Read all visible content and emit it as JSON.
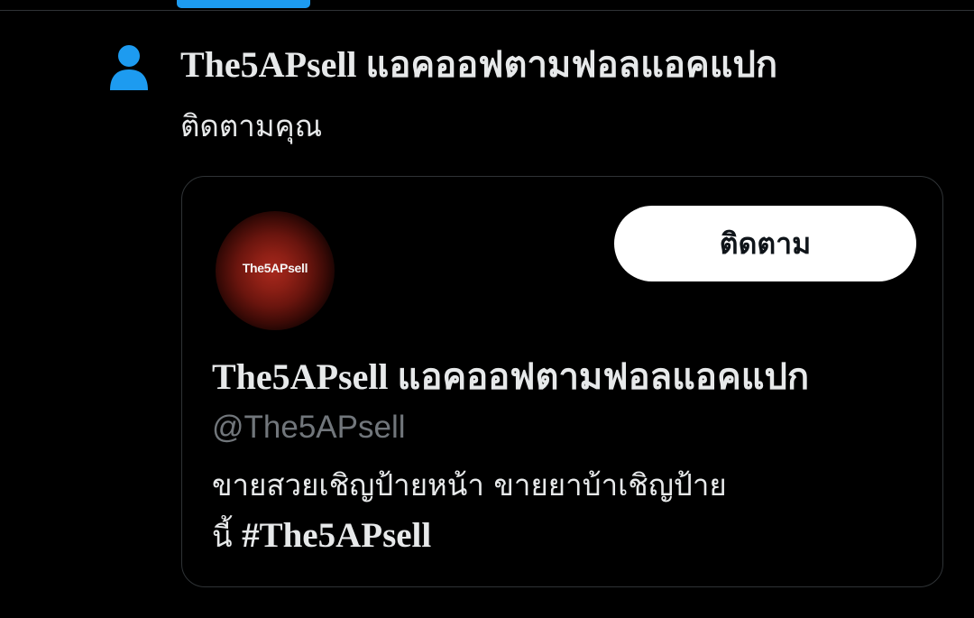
{
  "colors": {
    "background": "#000000",
    "text_primary": "#e7e9ea",
    "text_secondary": "#71767b",
    "accent": "#1d9bf0",
    "border": "#2f3336",
    "button_bg": "#ffffff",
    "button_text": "#0f1419"
  },
  "notification": {
    "icon": "person-icon",
    "title": "The5APsell แอคออฟตามฟอลแอคแปก",
    "action_text": "ติดตามคุณ"
  },
  "profile_card": {
    "avatar_text": "The5APsell",
    "follow_button_label": "ติดตาม",
    "display_name": "The5APsell แอคออฟตามฟอลแอคแปก",
    "handle": "@The5APsell",
    "bio_line1": "ขายสวยเชิญป้ายหน้า ขายยาบ้าเชิญป้าย",
    "bio_line2_prefix": "นี้ ",
    "bio_hashtag": "#The5APsell"
  }
}
